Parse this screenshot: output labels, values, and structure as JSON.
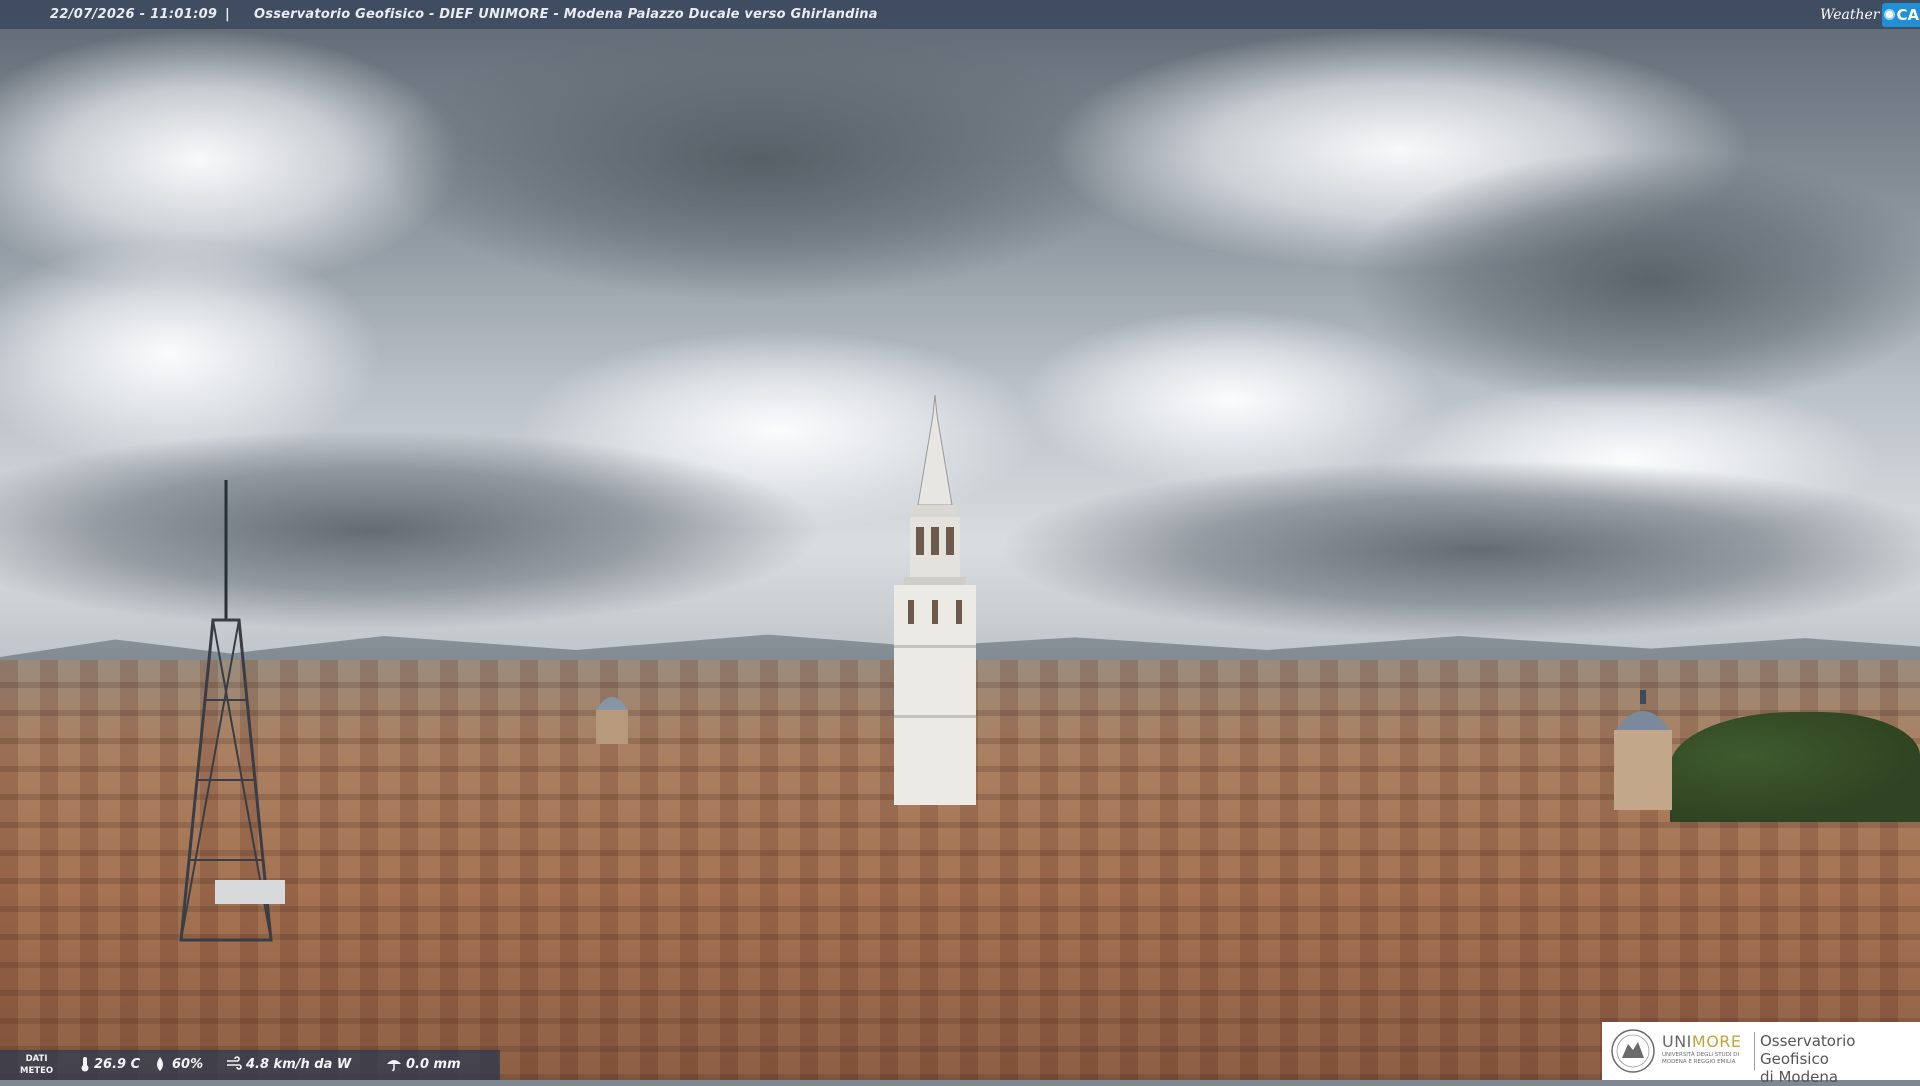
{
  "header": {
    "timestamp": "22/07/2026 - 11:01:09",
    "separator": "|",
    "title": "Osservatorio Geofisico - DIEF UNIMORE - Modena Palazzo Ducale verso Ghirlandina",
    "logo_word": "Weather",
    "logo_cam": "CAM"
  },
  "meteo": {
    "label_line1": "DATI",
    "label_line2": "METEO",
    "temperature": "26.9 C",
    "humidity": "60%",
    "wind": "4.8 km/h da W",
    "rain": "0.0 mm"
  },
  "branding": {
    "unimore_uni": "UNI",
    "unimore_more": "MORE",
    "unimore_sub": "UNIVERSITÀ DEGLI STUDI DI MODENA E REGGIO EMILIA",
    "observatory_line1": "Osservatorio Geofisico",
    "observatory_line2": "di Modena"
  },
  "colors": {
    "topbar": "#37445a",
    "accent_blue": "#1f8fd6",
    "unimore_gold": "#c6a23a"
  }
}
